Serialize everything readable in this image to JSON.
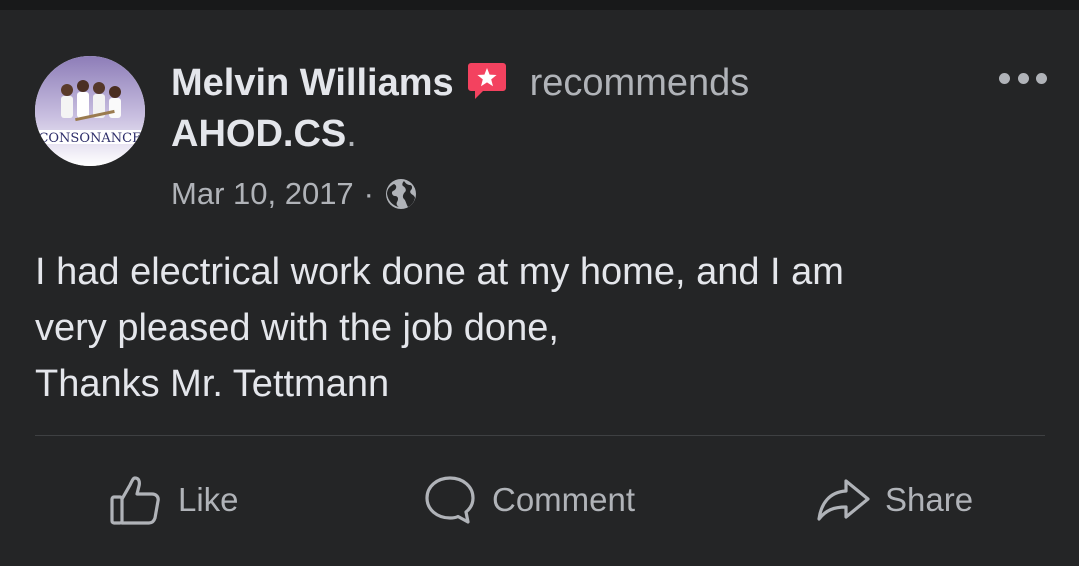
{
  "post": {
    "author": {
      "name": "Melvin Williams",
      "avatar_text": "CONSONANCE"
    },
    "action_text": "recommends",
    "page_name": "AHOD.CS",
    "page_suffix": ".",
    "timestamp": "Mar 10, 2017",
    "separator": "·",
    "audience_icon": "globe-icon",
    "body_lines": [
      "I had electrical work done at my home, and I am",
      "very pleased with the job done,",
      "Thanks Mr. Tettmann"
    ]
  },
  "actions": {
    "like_label": "Like",
    "comment_label": "Comment",
    "share_label": "Share"
  },
  "colors": {
    "background": "#242526",
    "primary_text": "#e4e6eb",
    "secondary_text": "#b0b3b8",
    "badge": "#f3425f"
  }
}
